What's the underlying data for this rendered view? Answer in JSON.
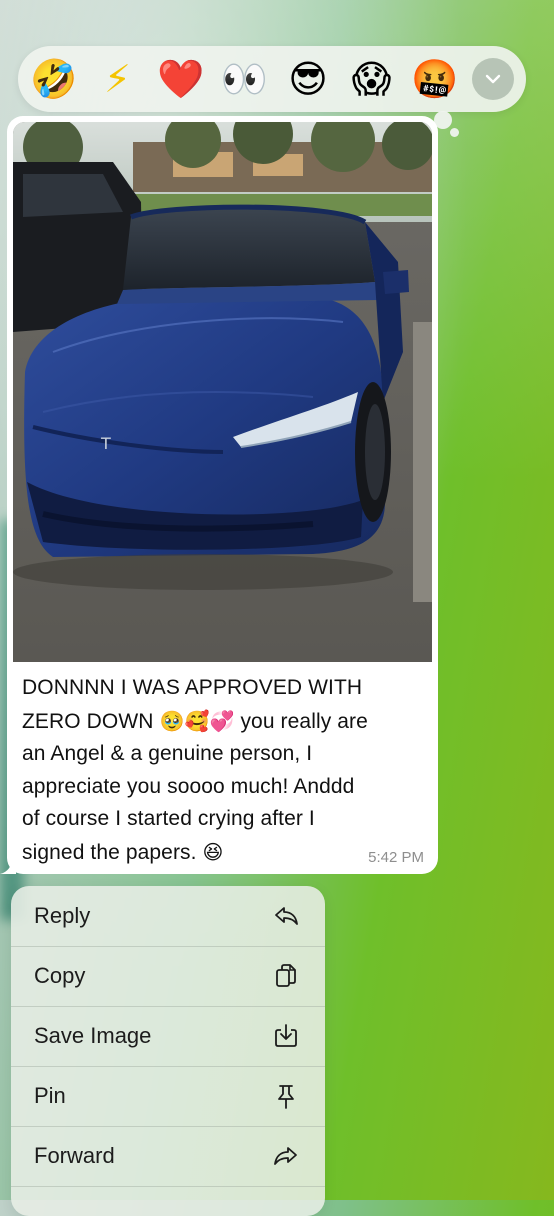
{
  "reactions": [
    {
      "name": "rofl-emoji",
      "glyph": "🤣"
    },
    {
      "name": "lightning-emoji",
      "glyph": "⚡"
    },
    {
      "name": "heart-emoji",
      "glyph": "❤️"
    },
    {
      "name": "eyes-emoji",
      "glyph": "👀"
    },
    {
      "name": "sunglasses-emoji",
      "glyph": "😎"
    },
    {
      "name": "scream-emoji",
      "glyph": "😱"
    },
    {
      "name": "cursing-emoji",
      "glyph": "🤬"
    }
  ],
  "expand_icon": "chevron-down-icon",
  "message": {
    "image_icon": "photo-of-blue-tesla",
    "text_line1": "DONNNN I WAS APPROVED WITH",
    "text_line2a": "ZERO DOWN ",
    "emoji_a": "🥹🥰💞",
    "text_line2b": " you really are",
    "text_line3": "an Angel & a genuine person, I",
    "text_line4": "appreciate you soooo much! Anddd",
    "text_line5": "of course I started crying after I",
    "text_line6": "signed the papers. ",
    "emoji_b": "😆",
    "time": "5:42 PM"
  },
  "menu": {
    "items": [
      {
        "label": "Reply",
        "icon": "reply-icon"
      },
      {
        "label": "Copy",
        "icon": "copy-icon"
      },
      {
        "label": "Save Image",
        "icon": "download-icon"
      },
      {
        "label": "Pin",
        "icon": "pin-icon"
      },
      {
        "label": "Forward",
        "icon": "forward-icon"
      }
    ]
  },
  "colors": {
    "accent_green": "#6fbf2a",
    "bubble": "#ffffff",
    "car_blue": "#1f3a7a"
  }
}
